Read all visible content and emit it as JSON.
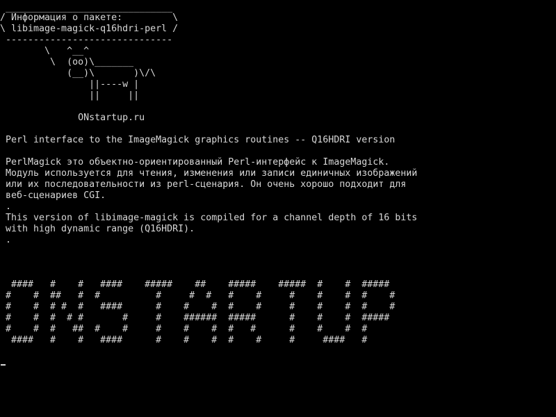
{
  "colors": {
    "background": "#000000",
    "foreground": "#d8d8d8"
  },
  "terminal": {
    "balloon": [
      " ______________________________",
      "/ Информация о пакете:         \\",
      "\\ libimage-magick-q16hdri-perl /",
      " ------------------------------"
    ],
    "cow": [
      "        \\   ^__^",
      "         \\  (oo)\\_______",
      "            (__)\\       )\\/\\",
      "                ||----w |",
      "                ||     ||"
    ],
    "site": "              ONstartup.ru",
    "summary": " Perl interface to the ImageMagick graphics routines -- Q16HDRI version",
    "description": [
      " PerlMagick это объектно-ориентированный Perl-интерфейс к ImageMagick.",
      " Модуль используется для чтения, изменения или записи единичных изображений",
      " или их последовательности из perl-сценария. Он очень хорошо подходит для",
      " веб-сценариев CGI.",
      " .",
      " This version of libimage-magick is compiled for a channel depth of 16 bits",
      " with high dynamic range (Q16HDRI).",
      " ."
    ],
    "banner": [
      "  ####   #    #   ####    #####    ##    #####    #####  #    #  #####",
      " #    #  ##   #  #          #     #  #   #    #     #    #    #  #    #",
      " #    #  # #  #   ####      #    #    #  #    #     #    #    #  #    #",
      " #    #  #  # #       #     #    ######  #####      #    #    #  #####",
      " #    #  #   ##  #    #     #    #    #  #   #      #    #    #  #",
      "  ####   #    #   ####      #    #    #  #    #     #     ####   #"
    ]
  }
}
